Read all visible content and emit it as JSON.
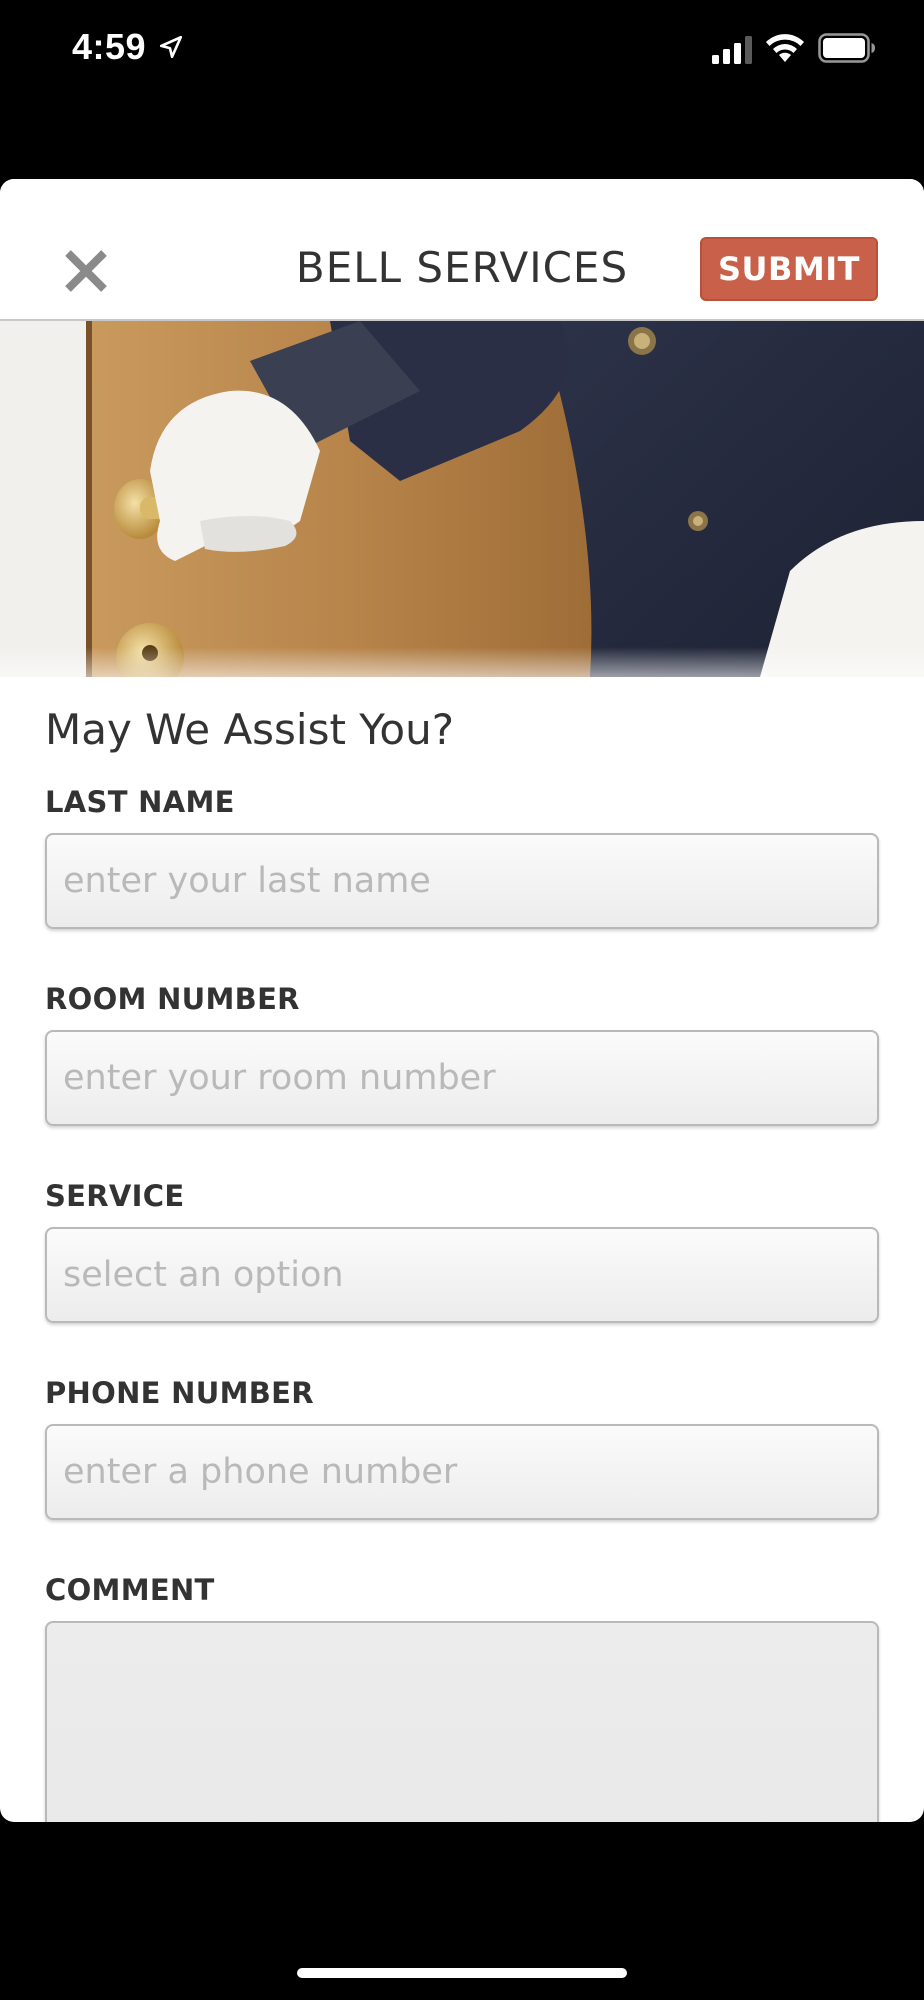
{
  "status_bar": {
    "time": "4:59",
    "icons": [
      "location-arrow-icon",
      "cellular-signal-icon",
      "wifi-icon",
      "battery-icon"
    ]
  },
  "header": {
    "title": "BELL SERVICES",
    "submit_label": "SUBMIT",
    "close_icon": "close-icon"
  },
  "colors": {
    "accent": "#c9614a",
    "text": "#333333",
    "placeholder": "#b9b9b9"
  },
  "form": {
    "heading": "May We Assist You?",
    "fields": [
      {
        "label": "LAST NAME",
        "placeholder": "enter your last name",
        "value": ""
      },
      {
        "label": "ROOM NUMBER",
        "placeholder": "enter your room number",
        "value": ""
      },
      {
        "label": "SERVICE",
        "placeholder": "select an option",
        "value": ""
      },
      {
        "label": "PHONE NUMBER",
        "placeholder": "enter a phone number",
        "value": ""
      },
      {
        "label": "COMMENT",
        "placeholder": "",
        "value": ""
      }
    ]
  }
}
